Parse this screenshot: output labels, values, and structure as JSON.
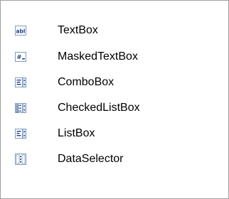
{
  "menu": {
    "items": [
      {
        "label": "TextBox",
        "icon": "textbox-icon"
      },
      {
        "label": "MaskedTextBox",
        "icon": "maskedtextbox-icon"
      },
      {
        "label": "ComboBox",
        "icon": "combobox-icon"
      },
      {
        "label": "CheckedListBox",
        "icon": "checkedlistbox-icon"
      },
      {
        "label": "ListBox",
        "icon": "listbox-icon"
      },
      {
        "label": "DataSelector",
        "icon": "dataselector-icon"
      }
    ]
  },
  "colors": {
    "border": "#a0a0a0",
    "icon_blue": "#3a5fa8",
    "icon_frame": "#7f9db9",
    "text": "#000000"
  }
}
